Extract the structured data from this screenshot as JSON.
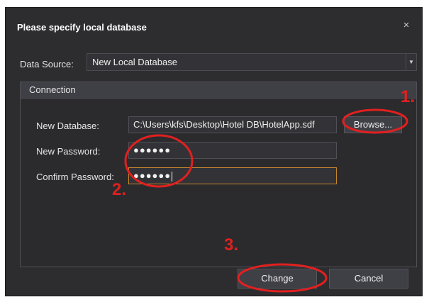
{
  "dialog": {
    "title": "Please specify local database",
    "close_glyph": "×"
  },
  "data_source": {
    "label": "Data Source:",
    "value": "New Local Database",
    "arrow_glyph": "▼"
  },
  "connection": {
    "header": "Connection",
    "new_database_label": "New Database:",
    "new_database_value": "C:\\Users\\kfs\\Desktop\\Hotel DB\\HotelApp.sdf",
    "browse_label": "Browse...",
    "new_password_label": "New Password:",
    "new_password_value": "●●●●●●",
    "confirm_password_label": "Confirm Password:",
    "confirm_password_value": "●●●●●●"
  },
  "buttons": {
    "change_label": "Change",
    "cancel_label": "Cancel"
  },
  "annotations": {
    "step1": "1.",
    "step2": "2.",
    "step3": "3.",
    "color": "#e02020"
  },
  "colors": {
    "dialog_bg": "#2d2d30",
    "focus_border": "#c8862b"
  }
}
